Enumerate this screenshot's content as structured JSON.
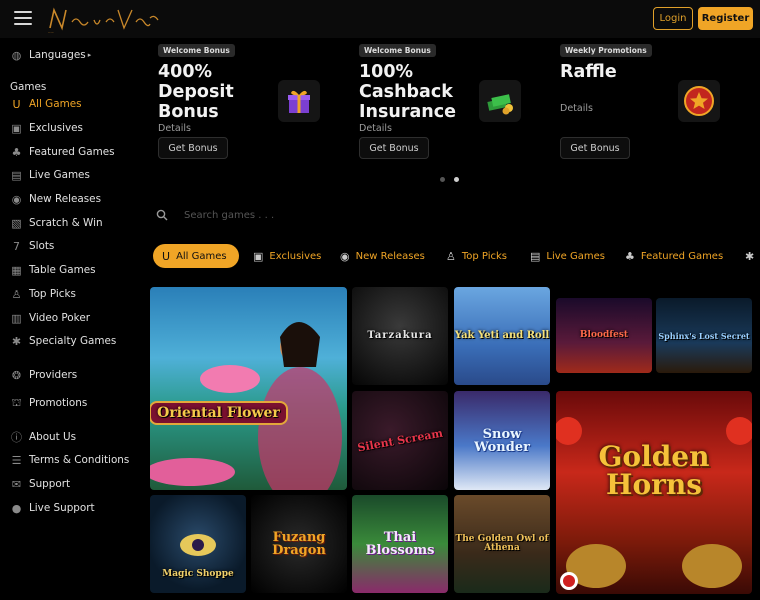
{
  "header": {
    "logo_text": "New Vegas",
    "login_label": "Login",
    "register_label": "Register"
  },
  "sidebar": {
    "languages_label": "Languages",
    "games_heading": "Games",
    "items": [
      {
        "label": "All Games",
        "icon": "horseshoe-icon"
      },
      {
        "label": "Exclusives",
        "icon": "exclusive-icon"
      },
      {
        "label": "Featured Games",
        "icon": "clover-icon"
      },
      {
        "label": "Live Games",
        "icon": "live-icon"
      },
      {
        "label": "New Releases",
        "icon": "new-releases-icon"
      },
      {
        "label": "Scratch & Win",
        "icon": "scratch-icon"
      },
      {
        "label": "Slots",
        "icon": "seven-icon"
      },
      {
        "label": "Table Games",
        "icon": "table-icon"
      },
      {
        "label": "Top Picks",
        "icon": "top-picks-icon"
      },
      {
        "label": "Video Poker",
        "icon": "video-poker-icon"
      },
      {
        "label": "Specialty Games",
        "icon": "specialty-icon"
      }
    ],
    "providers_label": "Providers",
    "promotions_label": "Promotions",
    "footer_items": [
      {
        "label": "About Us",
        "icon": "info-icon"
      },
      {
        "label": "Terms & Conditions",
        "icon": "document-icon"
      },
      {
        "label": "Support",
        "icon": "support-icon"
      },
      {
        "label": "Live Support",
        "icon": "chat-icon"
      }
    ]
  },
  "promos": [
    {
      "badge": "Welcome Bonus",
      "title": "400% Deposit Bonus",
      "details": "Details",
      "button": "Get Bonus",
      "icon": "gift-box-icon"
    },
    {
      "badge": "Welcome Bonus",
      "title": "100% Cashback Insurance",
      "details": "Details",
      "button": "Get Bonus",
      "icon": "cash-stack-icon"
    },
    {
      "badge": "Weekly Promotions",
      "title": "Raffle",
      "details": "Details",
      "button": "Get Bonus",
      "icon": "raffle-star-icon"
    }
  ],
  "carousel": {
    "slides": 2,
    "active": 2
  },
  "search": {
    "placeholder": "Search games . . ."
  },
  "tabs": [
    {
      "label": "All Games",
      "icon": "horseshoe-icon",
      "active": true
    },
    {
      "label": "Exclusives",
      "icon": "exclusive-icon"
    },
    {
      "label": "New Releases",
      "icon": "new-releases-icon"
    },
    {
      "label": "Top Picks",
      "icon": "top-picks-icon"
    },
    {
      "label": "Live Games",
      "icon": "live-icon"
    },
    {
      "label": "Featured Games",
      "icon": "clover-icon"
    }
  ],
  "games": [
    {
      "title": "Oriental Flower"
    },
    {
      "title": "Tarzakura"
    },
    {
      "title": "Yak Yeti and Roll"
    },
    {
      "title": "Bloodfest"
    },
    {
      "title": "Sphinx's Lost Secret"
    },
    {
      "title": "Silent Scream"
    },
    {
      "title": "Snow Wonder"
    },
    {
      "title": "Golden Horns"
    },
    {
      "title": "Magic Shoppe"
    },
    {
      "title": "Fuzang Dragon"
    },
    {
      "title": "Thai Blossoms"
    },
    {
      "title": "The Golden Owl of Athena"
    }
  ],
  "colors": {
    "accent": "#f0a526",
    "background": "#000000"
  }
}
